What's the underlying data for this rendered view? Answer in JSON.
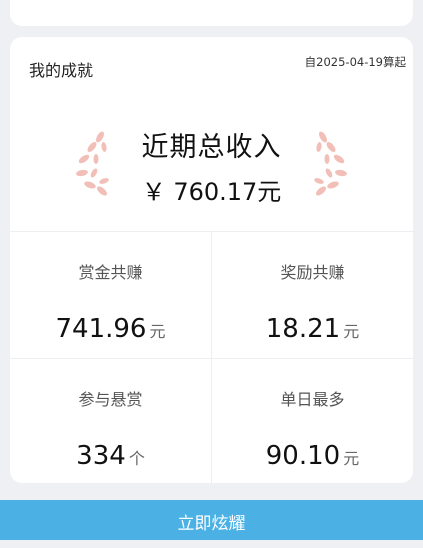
{
  "achievement": {
    "title": "我的成就",
    "since": "自2025-04-19算起",
    "summary": {
      "label": "近期总收入",
      "value": "￥ 760.17元"
    },
    "stats": [
      {
        "label": "赏金共赚",
        "value": "741.96",
        "unit": "元"
      },
      {
        "label": "奖励共赚",
        "value": "18.21",
        "unit": "元"
      },
      {
        "label": "参与悬赏",
        "value": "334",
        "unit": "个"
      },
      {
        "label": "单日最多",
        "value": "90.10",
        "unit": "元"
      }
    ]
  },
  "cta": {
    "label": "立即炫耀"
  },
  "colors": {
    "accent": "#4bb1e5",
    "laurel": "#f2bfb8",
    "background": "#eef0f3"
  },
  "icons": {
    "laurel_left": "laurel-left-icon",
    "laurel_right": "laurel-right-icon"
  }
}
